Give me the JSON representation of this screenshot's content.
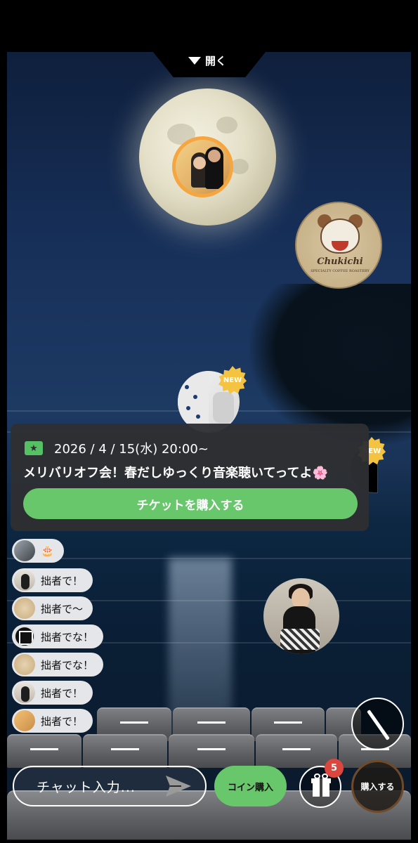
{
  "header": {
    "open_label": "開く"
  },
  "event": {
    "date": "2026 / 4 / 15(水) 20:00~",
    "title": "メリバリオフ会！春だしゆっくり音楽聴いてってよ🌸",
    "ticket_button": "チケットを購入する"
  },
  "badges": {
    "new": "NEW"
  },
  "cafe_logo": {
    "line1": "Chukichi",
    "line2": "SPECIALTY COFFEE ROASTERY"
  },
  "chat": {
    "messages": [
      {
        "text": "🎂"
      },
      {
        "text": "拙者で！"
      },
      {
        "text": "拙者で〜"
      },
      {
        "text": "拙者でな！"
      },
      {
        "text": "拙者でな！"
      },
      {
        "text": "拙者で！"
      },
      {
        "text": "拙者で！"
      }
    ]
  },
  "controls": {
    "chat_placeholder": "チャット入力...",
    "coin_purchase": "コイン購入",
    "gift_count": "5",
    "buy_label": "購入する"
  }
}
